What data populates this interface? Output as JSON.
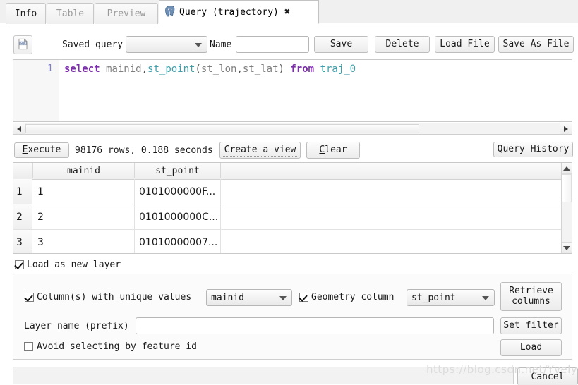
{
  "window": {
    "tabs": [
      {
        "label": "Info",
        "active": false
      },
      {
        "label": "Table",
        "active": false
      },
      {
        "label": "Preview",
        "active": false
      },
      {
        "label": "Query (trajectory)",
        "active": true,
        "icon": "postgresql-elephant-icon",
        "close": "✖"
      }
    ]
  },
  "toolbar": {
    "sql_icon": "sql-document-icon",
    "saved_query_label": "Saved query",
    "saved_query_value": "",
    "name_label": "Name",
    "name_value": "",
    "name_placeholder": "",
    "save_label": "Save",
    "delete_label": "Delete",
    "load_file_label": "Load File",
    "save_as_file_label": "Save As File"
  },
  "editor": {
    "line_number": "1",
    "sql_tokens": {
      "select": "select",
      "space1": " ",
      "col_mainid": "mainid",
      "comma1": ",",
      "func": "st_point",
      "paren_open": "(",
      "arg1": "st_lon",
      "comma2": ",",
      "arg2": "st_lat",
      "paren_close": ")",
      "space2": " ",
      "from": "from",
      "space3": " ",
      "table": "traj_0"
    },
    "full_sql": "select mainid,st_point(st_lon,st_lat) from traj_0"
  },
  "status": {
    "execute_label_pre": "E",
    "execute_label_post": "xecute",
    "result_text": "98176 rows,  0.188 seconds",
    "rows": 98176,
    "seconds": 0.188,
    "create_view_label": "Create a view",
    "clear_label_pre": "C",
    "clear_label_post": "lear",
    "query_history_label": "Query History"
  },
  "results": {
    "columns": [
      "",
      "mainid",
      "st_point",
      ""
    ],
    "rows": [
      {
        "index": "1",
        "mainid": "1",
        "st_point": "0101000000F..."
      },
      {
        "index": "2",
        "mainid": "2",
        "st_point": "0101000000C..."
      },
      {
        "index": "3",
        "mainid": "3",
        "st_point": "01010000007..."
      }
    ]
  },
  "options": {
    "load_as_new_layer_label": "Load as new layer",
    "load_as_new_layer_checked": true,
    "unique_values_label": "Column(s) with unique values",
    "unique_values_checked": true,
    "unique_values_selected": "mainid",
    "geometry_column_label": "Geometry column",
    "geometry_column_checked": true,
    "geometry_column_selected": "st_point",
    "retrieve_columns_line1": "Retrieve",
    "retrieve_columns_line2": "columns",
    "layer_name_label": "Layer name (prefix)",
    "layer_name_value": "",
    "layer_name_placeholder": "",
    "set_filter_label": "Set filter",
    "avoid_feature_id_label": "Avoid selecting by feature id",
    "avoid_feature_id_checked": false,
    "load_label": "Load"
  },
  "footer": {
    "cancel_label": "Cancel",
    "watermark": "https://blog.csdn.net/Yvelyne"
  },
  "colors": {
    "keyword": "#7b2fa8",
    "identifier": "#7f7f7f",
    "function": "#3f9ea8",
    "line_number": "#8080c0",
    "tab_inactive": "#9a9a9a"
  }
}
